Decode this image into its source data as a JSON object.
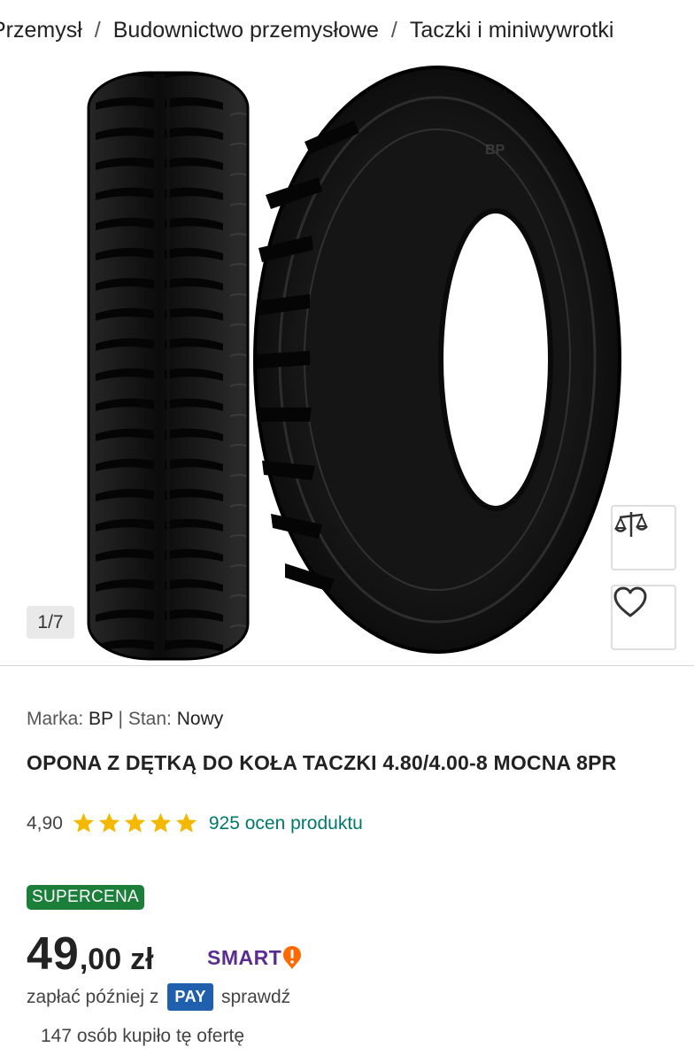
{
  "breadcrumb": {
    "items": [
      "Przemysł",
      "Budownictwo przemysłowe",
      "Taczki i miniwywrotki"
    ],
    "separator": "/"
  },
  "gallery": {
    "counter": "1/7",
    "tire_brand_mark": "BP",
    "compare_icon": "scale-icon",
    "wishlist_icon": "heart-icon"
  },
  "product": {
    "brand_label": "Marka:",
    "brand_value": "BP",
    "divider": "|",
    "condition_label": "Stan:",
    "condition_value": "Nowy",
    "title": "OPONA Z DĘTKĄ DO KOŁA TACZKI 4.80/4.00-8 MOCNA 8PR",
    "rating": {
      "score": "4,90",
      "stars": 5,
      "count_text": "925 ocen produktu"
    },
    "badge": "SUPERCENA",
    "price": {
      "integer": "49",
      "fraction": ",00",
      "currency": "zł"
    },
    "smart_label": "SMART",
    "pay_later": {
      "prefix": "zapłać później z",
      "badge": "PAY",
      "link": "sprawdź"
    },
    "bought_text": "147 osób kupiło tę ofertę"
  },
  "colors": {
    "accent_green": "#1b7f3a",
    "star_yellow": "#f5b800",
    "link_teal": "#00796b",
    "smart_purple": "#5b2d90",
    "smart_orange": "#ff6a00",
    "pay_blue": "#1f5fae"
  }
}
